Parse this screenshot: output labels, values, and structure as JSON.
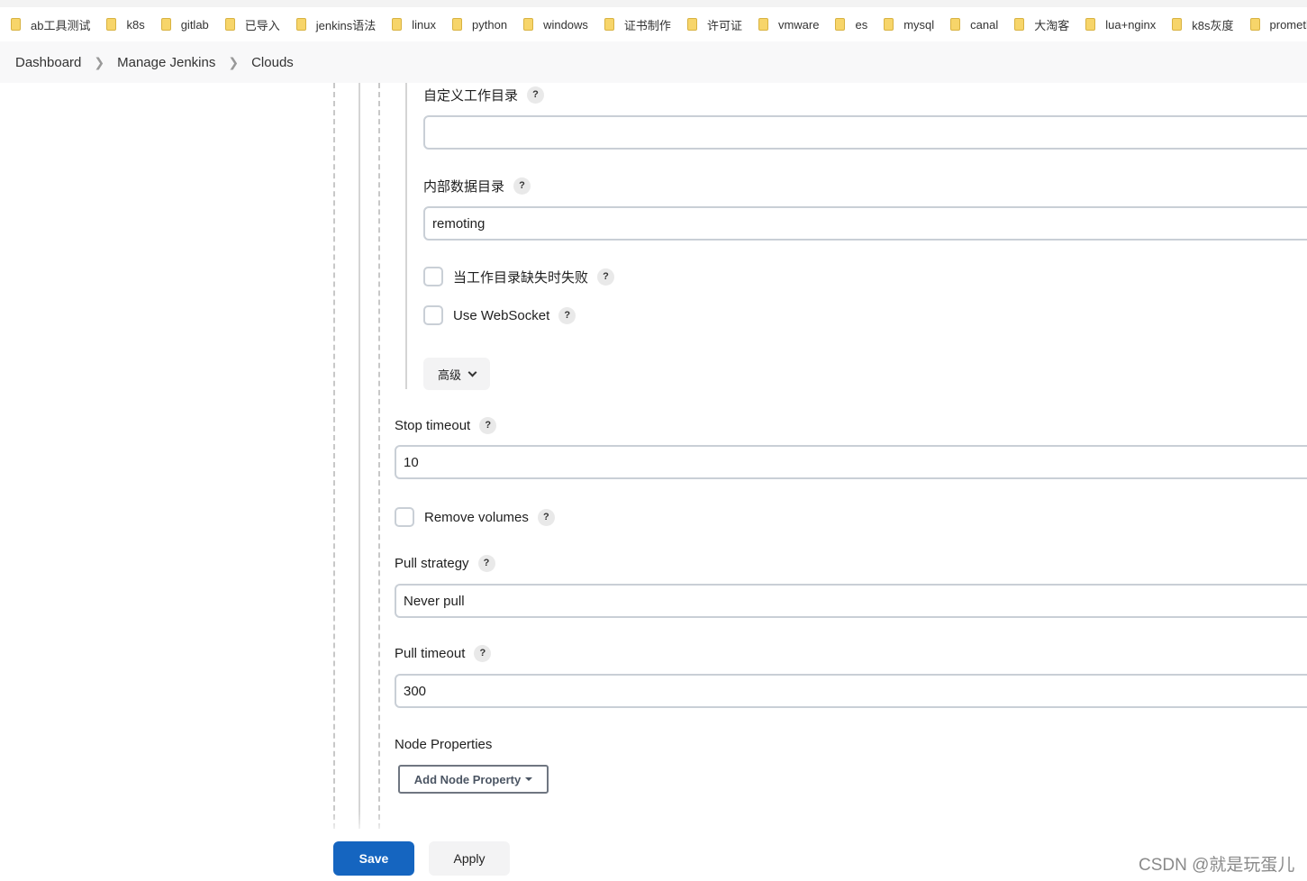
{
  "bookmarks": [
    "ab工具测试",
    "k8s",
    "gitlab",
    "已导入",
    "jenkins语法",
    "linux",
    "python",
    "windows",
    "证书制作",
    "许可证",
    "vmware",
    "es",
    "mysql",
    "canal",
    "大淘客",
    "lua+nginx",
    "k8s灰度",
    "prometh"
  ],
  "breadcrumb": {
    "dashboard": "Dashboard",
    "manage_jenkins": "Manage Jenkins",
    "clouds": "Clouds"
  },
  "form": {
    "custom_workdir": {
      "label": "自定义工作目录",
      "value": ""
    },
    "internal_data_dir": {
      "label": "内部数据目录",
      "value": "remoting"
    },
    "fail_if_workdir_missing": {
      "label": "当工作目录缺失时失败",
      "checked": false
    },
    "use_websocket": {
      "label": "Use WebSocket",
      "checked": false
    },
    "advanced_label": "高级",
    "stop_timeout": {
      "label": "Stop timeout",
      "value": "10"
    },
    "remove_volumes": {
      "label": "Remove volumes",
      "checked": false
    },
    "pull_strategy": {
      "label": "Pull strategy",
      "value": "Never pull"
    },
    "pull_timeout": {
      "label": "Pull timeout",
      "value": "300"
    },
    "node_properties": {
      "label": "Node Properties",
      "add_button": "Add Node Property"
    },
    "help_glyph": "?"
  },
  "actions": {
    "save": "Save",
    "apply": "Apply"
  },
  "watermark": "CSDN @就是玩蛋儿",
  "colors": {
    "primary": "#1565c0",
    "folder": "#f7d56a",
    "border": "#c9cfd6"
  }
}
